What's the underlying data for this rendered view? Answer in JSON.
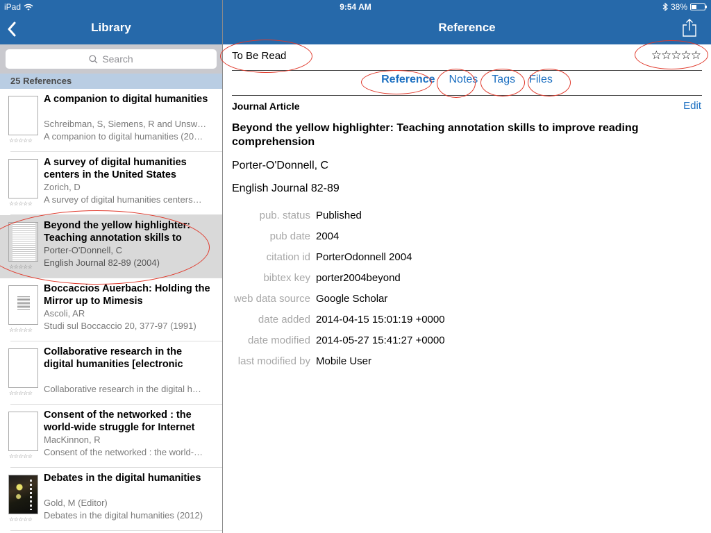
{
  "status_bar": {
    "device": "iPad",
    "wifi_icon": "wifi-icon",
    "time": "9:54 AM",
    "bluetooth_icon": "bluetooth-icon",
    "battery_percent": "38%",
    "battery_level": 0.38
  },
  "left_nav": {
    "back_icon": "chevron-left-icon",
    "title": "Library"
  },
  "right_nav": {
    "title": "Reference",
    "share_icon": "share-icon"
  },
  "search": {
    "placeholder": "Search",
    "icon": "search-icon"
  },
  "list_header": "25 References",
  "references": [
    {
      "title": "A companion to digital humanities",
      "authors": "Schreibman, S, Siemens, R and Unsw…",
      "source": "A companion to digital humanities (20…",
      "thumb": "blank",
      "rating": 0,
      "selected": false
    },
    {
      "title": "A survey of digital humanities centers in the United States",
      "authors": "Zorich, D",
      "source": "A survey of digital humanities centers…",
      "thumb": "blank",
      "rating": 0,
      "selected": false
    },
    {
      "title": "Beyond the yellow highlighter: Teaching annotation skills to",
      "authors": "Porter-O'Donnell, C",
      "source": "English Journal 82-89 (2004)",
      "thumb": "document",
      "rating": 0,
      "selected": true
    },
    {
      "title": "Boccaccios Auerbach: Holding the Mirror up to Mimesis",
      "authors": "Ascoli, AR",
      "source": "Studi sul Boccaccio 20, 377-97 (1991)",
      "thumb": "document-small",
      "rating": 0,
      "selected": false
    },
    {
      "title": "Collaborative research in the digital humanities [electronic",
      "authors": "",
      "source": "Collaborative research in the digital h…",
      "thumb": "blank",
      "rating": 0,
      "selected": false
    },
    {
      "title": "Consent of the networked : the world-wide struggle for Internet",
      "authors": "MacKinnon, R",
      "source": "Consent of the networked : the world-…",
      "thumb": "blank",
      "rating": 0,
      "selected": false
    },
    {
      "title": "Debates in the digital humanities",
      "authors": "Gold, M (Editor)",
      "source": "Debates in the digital humanities (2012)",
      "thumb": "cover",
      "rating": 0,
      "selected": false
    }
  ],
  "detail": {
    "folder": "To Be Read",
    "rating_stars": "☆☆☆☆☆",
    "rating": 0,
    "tabs": [
      {
        "label": "Reference",
        "active": true
      },
      {
        "label": "Notes",
        "active": false
      },
      {
        "label": "Tags",
        "active": false
      },
      {
        "label": "Files",
        "active": false
      }
    ],
    "type": "Journal Article",
    "edit_label": "Edit",
    "title": "Beyond the yellow highlighter: Teaching annotation skills to improve reading comprehension",
    "author": "Porter-O'Donnell, C",
    "journal": "English Journal 82-89",
    "fields": [
      {
        "label": "pub. status",
        "value": "Published"
      },
      {
        "label": "pub date",
        "value": "2004"
      },
      {
        "label": "citation id",
        "value": "PorterOdonnell 2004"
      },
      {
        "label": "bibtex key",
        "value": "porter2004beyond"
      },
      {
        "label": "web data source",
        "value": "Google Scholar"
      },
      {
        "label": "date added",
        "value": "2014-04-15 15:01:19 +0000"
      },
      {
        "label": "date modified",
        "value": "2014-05-27 15:41:27 +0000"
      },
      {
        "label": "last modified by",
        "value": "Mobile User"
      }
    ]
  },
  "mini_stars": "☆☆☆☆☆",
  "colors": {
    "nav_bar": "#2669aa",
    "accent_link": "#1b6fc1",
    "annotation": "#e0392b",
    "list_header_bg": "#b9cde3",
    "selected_row_bg": "#d9d9d9"
  }
}
